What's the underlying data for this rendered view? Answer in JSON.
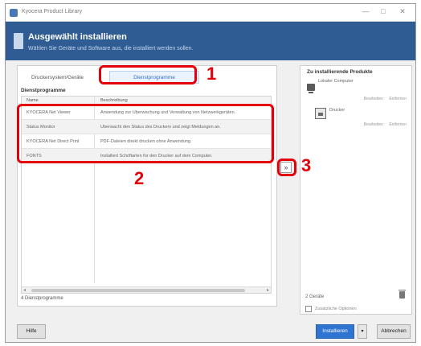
{
  "window": {
    "title": "Kyocera Product Library",
    "controls": [
      "—",
      "□",
      "✕"
    ]
  },
  "header": {
    "title": "Ausgewählt installieren",
    "subtitle": "Wählen Sie Geräte und Software aus, die installiert werden sollen."
  },
  "tabs": [
    {
      "label": "Druckersystem/Geräte"
    },
    {
      "label": "Dienstprogramme"
    }
  ],
  "section_label": "Dienstprogramme",
  "grid": {
    "columns": [
      "Name",
      "Beschreibung"
    ],
    "rows": [
      {
        "name": "KYOCERA Net Viewer",
        "desc": "Anwendung zur Überwachung und Verwaltung von Netzwerkgeräten."
      },
      {
        "name": "Status Monitor",
        "desc": "Überwacht den Status des Druckers und zeigt Meldungen an."
      },
      {
        "name": "KYOCERA Net Direct Print",
        "desc": "PDF-Dateien direkt drucken ohne Anwendung."
      },
      {
        "name": "FONTS",
        "desc": "Installiert Schriftarten für den Drucker auf dem Computer."
      }
    ],
    "footer": "4 Dienstprogramme"
  },
  "add_button": {
    "label": "»"
  },
  "right_panel": {
    "title": "Zu installierende Produkte",
    "computer_name": "Lokaler Computer",
    "printer_name": "Drucker",
    "links": [
      "Bearbeiten",
      "Entfernen"
    ],
    "bottom_count": "2 Geräte",
    "checkbox_label": "Zusätzliche Optionen"
  },
  "footer": {
    "help": "Hilfe",
    "install": "Installieren",
    "dropdown": "▾",
    "cancel": "Abbrechen"
  },
  "callouts": [
    "1",
    "2",
    "3"
  ],
  "colors": {
    "callout": "#e3000b",
    "header": "#2f5d93",
    "accent": "#2f74d0"
  }
}
